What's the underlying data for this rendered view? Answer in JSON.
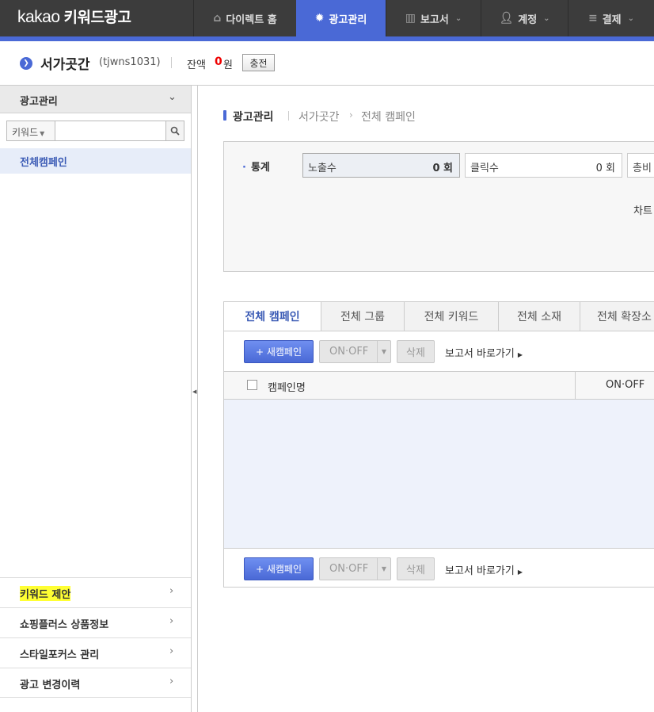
{
  "brand": {
    "kakao": "kakao",
    "product": "키워드광고"
  },
  "nav": [
    {
      "label": "다이렉트 홈",
      "icon": "home-icon"
    },
    {
      "label": "광고관리",
      "icon": "gear-icon",
      "active": true
    },
    {
      "label": "보고서",
      "icon": "bar-chart-icon"
    },
    {
      "label": "계정",
      "icon": "user-icon"
    },
    {
      "label": "결제",
      "icon": "database-icon"
    }
  ],
  "account": {
    "name": "서가곳간",
    "id": "(tjwns1031)",
    "balance_label": "잔액",
    "balance": "0",
    "balance_unit": "원",
    "charge_label": "충전"
  },
  "sidebar": {
    "header": "광고관리",
    "search_select": "키워드",
    "search_placeholder": "",
    "active_item": "전체캠페인",
    "bottom_items": [
      {
        "label": "키워드 제안",
        "highlighted": true
      },
      {
        "label": "쇼핑플러스 상품정보"
      },
      {
        "label": "스타일포커스 관리"
      },
      {
        "label": "광고 변경이력"
      }
    ]
  },
  "breadcrumb": {
    "section": "광고관리",
    "account": "서가곳간",
    "page": "전체 캠페인"
  },
  "stats": {
    "label": "통계",
    "cells": [
      {
        "name": "노출수",
        "value": "0 회",
        "selected": true
      },
      {
        "name": "클릭수",
        "value": "0 회"
      },
      {
        "name": "총비",
        "value": ""
      }
    ],
    "chart_label": "차트"
  },
  "tabs": [
    "전체 캠페인",
    "전체 그룹",
    "전체 키워드",
    "전체 소재",
    "전체 확장소"
  ],
  "toolbar": {
    "new_campaign": "+ 새캠페인",
    "onoff": "ON·OFF",
    "delete": "삭제",
    "report_link": "보고서 바로가기"
  },
  "table": {
    "columns": [
      "캠페인명",
      "ON·OFF"
    ]
  }
}
